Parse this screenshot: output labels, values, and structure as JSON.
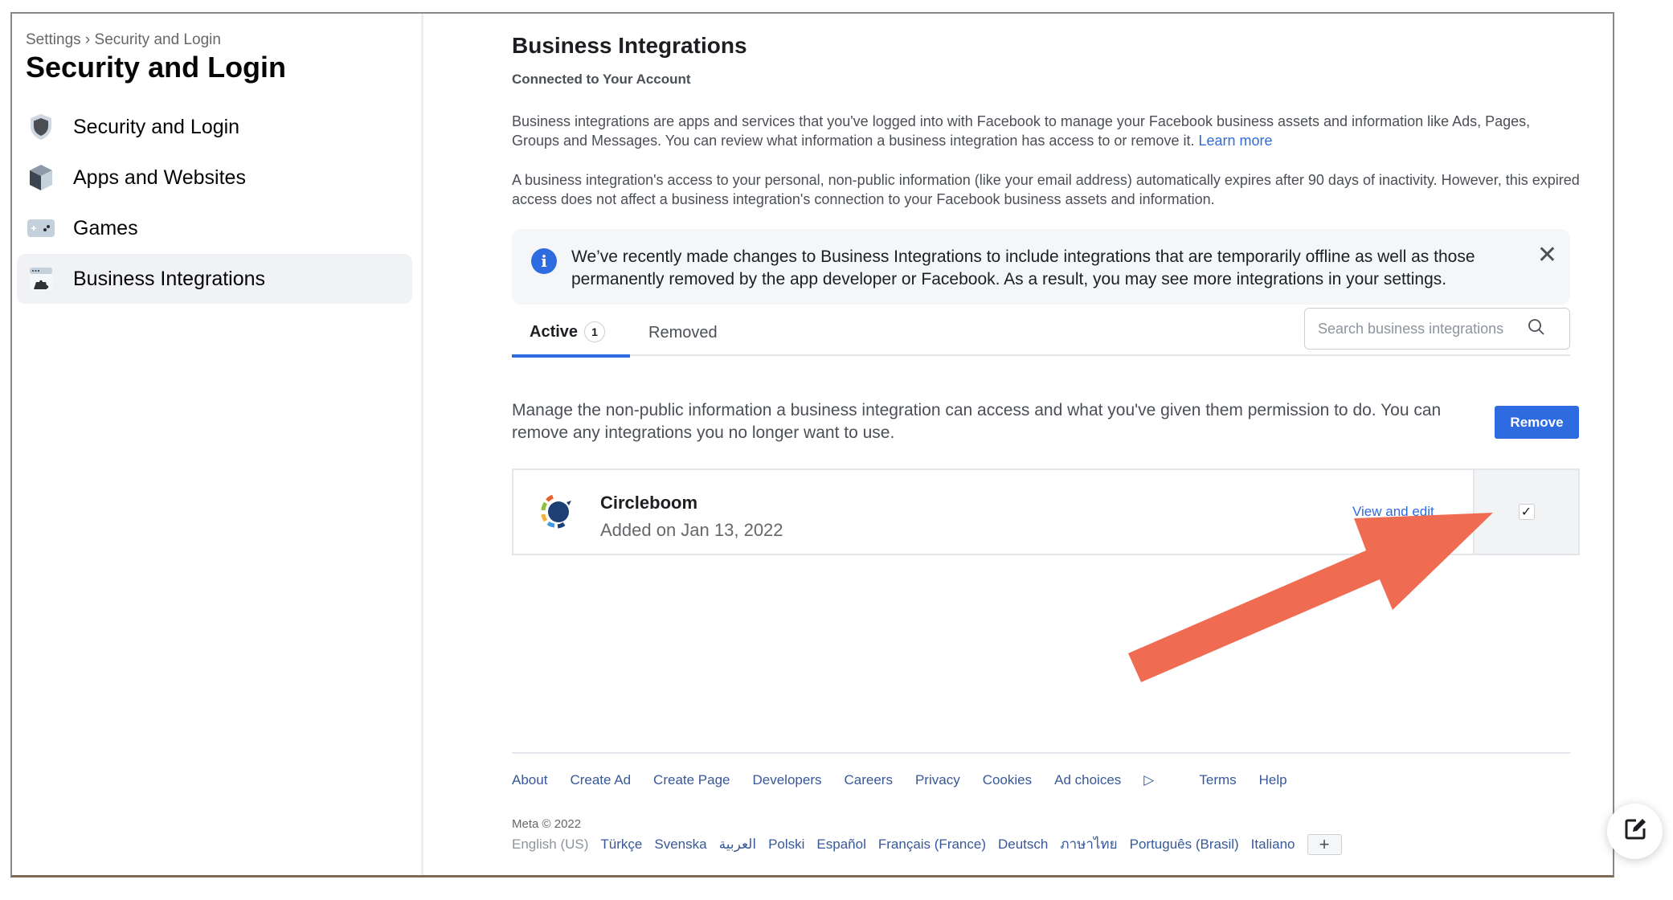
{
  "sidebar": {
    "breadcrumb": "Settings › Security and Login",
    "title": "Security and Login",
    "items": [
      {
        "label": "Security and Login",
        "icon": "shield-icon",
        "active": false
      },
      {
        "label": "Apps and Websites",
        "icon": "cube-icon",
        "active": false
      },
      {
        "label": "Games",
        "icon": "gamepad-icon",
        "active": false
      },
      {
        "label": "Business Integrations",
        "icon": "puzzle-window-icon",
        "active": true
      }
    ]
  },
  "main": {
    "title": "Business Integrations",
    "subtitle": "Connected to Your Account",
    "para1": "Business integrations are apps and services that you've logged into with Facebook to manage your Facebook business assets and information like Ads, Pages, Groups and Messages. You can review what information a business integration has access to or remove it.",
    "learn_more": "Learn more",
    "para2": "A business integration's access to your personal, non-public information (like your email address) automatically expires after 90 days of inactivity. However, this expired access does not affect a business integration's connection to your Facebook business assets and information.",
    "notice": "We’ve recently made changes to Business Integrations to include integrations that are temporarily offline as well as those permanently removed by the app developer or Facebook. As a result, you may see more integrations in your settings.",
    "tabs": [
      {
        "label": "Active",
        "count": "1"
      },
      {
        "label": "Removed"
      }
    ],
    "search_placeholder": "Search business integrations",
    "manage_text": "Manage the non-public information a business integration can access and what you've given them permission to do. You can remove any integrations you no longer want to use.",
    "remove_label": "Remove",
    "integrations": [
      {
        "name": "Circleboom",
        "added": "Added on Jan 13, 2022",
        "action": "View and edit",
        "checked": true
      }
    ]
  },
  "footer": {
    "links": [
      "About",
      "Create Ad",
      "Create Page",
      "Developers",
      "Careers",
      "Privacy",
      "Cookies",
      "Ad choices",
      "Terms",
      "Help"
    ],
    "copyright": "Meta © 2022",
    "current_language": "English (US)",
    "languages": [
      "Türkçe",
      "Svenska",
      "العربية",
      "Polski",
      "Español",
      "Français (France)",
      "Deutsch",
      "ภาษาไทย",
      "Português (Brasil)",
      "Italiano"
    ],
    "more_languages": "+"
  },
  "colors": {
    "accent": "#2e6ae0",
    "annotation_arrow": "#ef6c53"
  }
}
